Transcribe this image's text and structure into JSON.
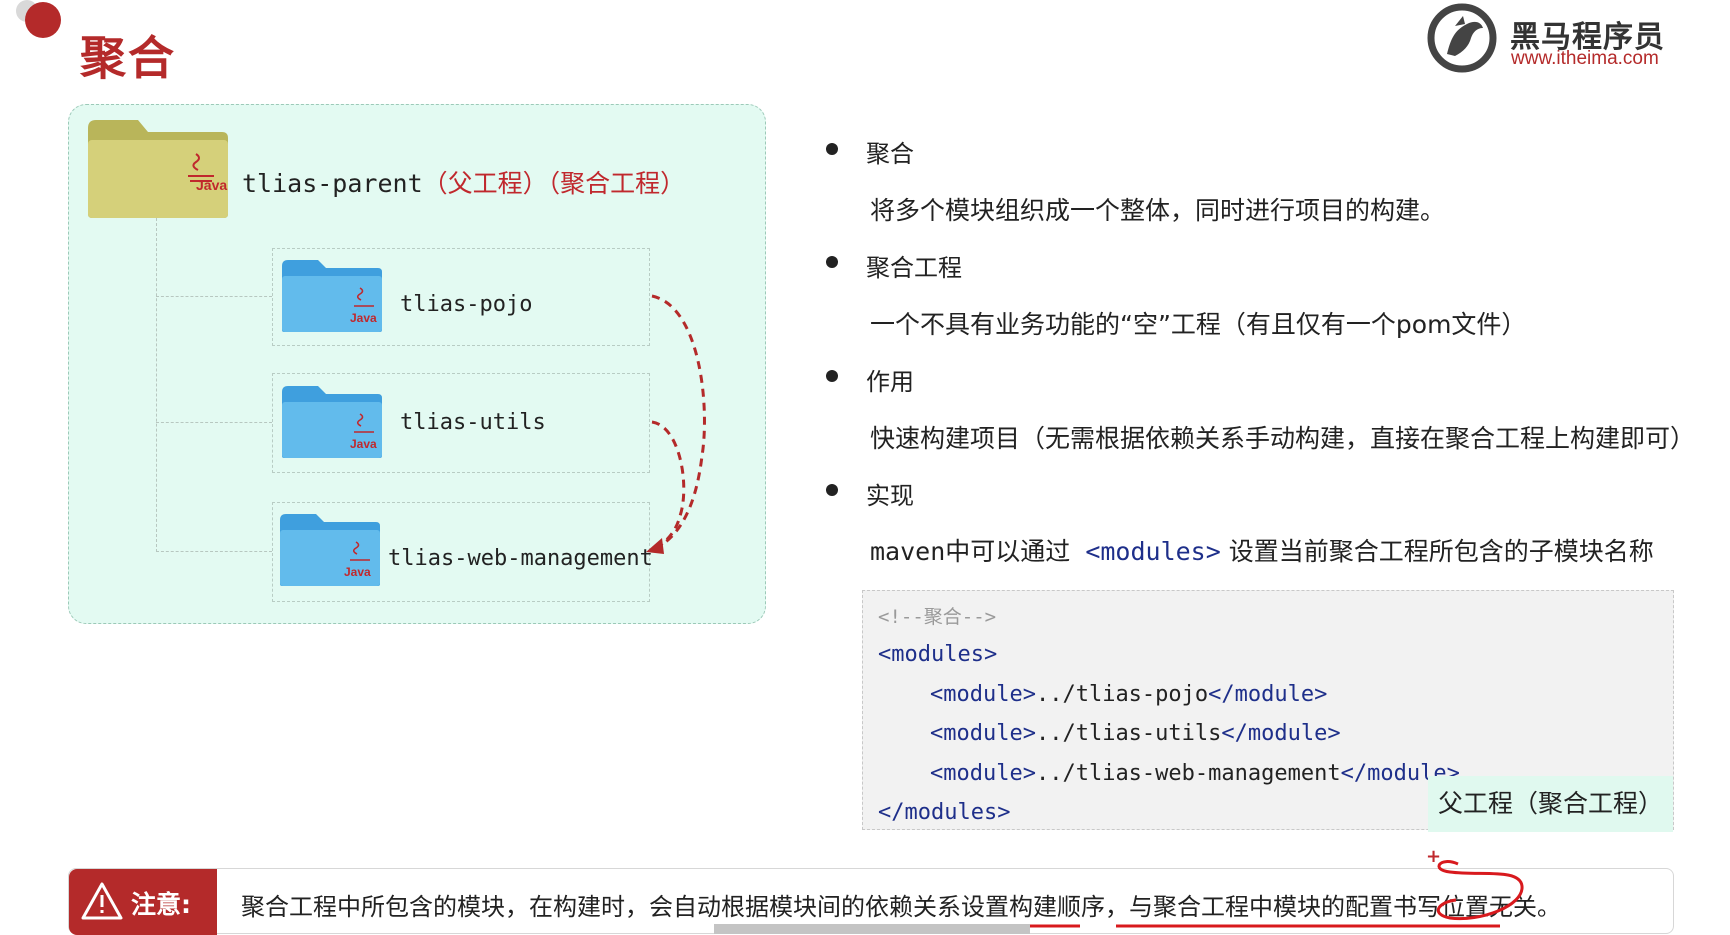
{
  "page": {
    "title": "聚合"
  },
  "logo": {
    "name": "黑马程序员",
    "url": "www.itheima.com"
  },
  "diagram": {
    "parent": {
      "name": "tlias-parent",
      "note": "（父工程）（聚合工程）",
      "icon": "java-folder-icon"
    },
    "modules": [
      {
        "name": "tlias-pojo"
      },
      {
        "name": "tlias-utils"
      },
      {
        "name": "tlias-web-management"
      }
    ],
    "java_label": "Java",
    "colors": {
      "parent_folder": "#c9c46a",
      "module_folder": "#5eb6ea",
      "arrow": "#b42a2a"
    }
  },
  "bullets": [
    {
      "head": "聚合",
      "body": "将多个模块组织成一个整体，同时进行项目的构建。"
    },
    {
      "head": "聚合工程",
      "body": "一个不具有业务功能的“空”工程（有且仅有一个pom文件）"
    },
    {
      "head": "作用",
      "body": "快速构建项目（无需根据依赖关系手动构建，直接在聚合工程上构建即可）"
    },
    {
      "head": "实现",
      "body_prefix": "maven中可以通过 ",
      "body_tag": "<modules>",
      "body_suffix": " 设置当前聚合工程所包含的子模块名称"
    }
  ],
  "code": {
    "comment": "<!--聚合-->",
    "open": "<modules>",
    "lines": [
      {
        "open": "<module>",
        "path": "../tlias-pojo",
        "close": "</module>"
      },
      {
        "open": "<module>",
        "path": "../tlias-utils",
        "close": "</module>"
      },
      {
        "open": "<module>",
        "path": "../tlias-web-management",
        "close": "</module>"
      }
    ],
    "close": "</modules>",
    "overlay": "父工程（聚合工程）"
  },
  "note": {
    "label": "注意:",
    "text": "聚合工程中所包含的模块，在构建时，会自动根据模块间的依赖关系设置构建顺序，与聚合工程中模块的配置书写位置无关。",
    "accent": "#b42a2a"
  }
}
